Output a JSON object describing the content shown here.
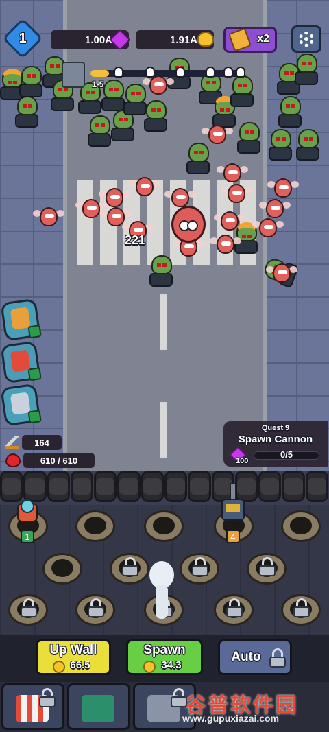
{
  "hud": {
    "player_level": "1",
    "gems": "1.00A",
    "gold": "1.91A",
    "boost_multiplier": "x2",
    "icons": {
      "gem": "gem-icon",
      "gold": "gold-coin-icon",
      "boost": "boost-icon",
      "settings": "gear-icon"
    }
  },
  "wave": {
    "label": "1-5",
    "progress": 0.12,
    "skull_count": 6
  },
  "battle": {
    "damage_number": "221"
  },
  "stats": {
    "attack": "164",
    "health": "610 / 610"
  },
  "quest": {
    "title": "Quest 9",
    "name": "Spawn Cannon",
    "progress": "0/5",
    "reward": "100"
  },
  "turrets": {
    "slot_1_level": "1",
    "slot_2_level": "4"
  },
  "controls": {
    "upwall_label": "Up Wall",
    "upwall_cost": "66.5",
    "spawn_label": "Spawn",
    "spawn_cost": "34.3",
    "auto_label": "Auto"
  },
  "watermark": {
    "cn": "谷普软件园",
    "url": "www.gupuxiazai.com"
  },
  "colors": {
    "upwall": "#e9de3a",
    "spawn": "#68cf44",
    "auto": "#5a6a98",
    "gem": "#c33ae6",
    "gold": "#f5c22a"
  }
}
